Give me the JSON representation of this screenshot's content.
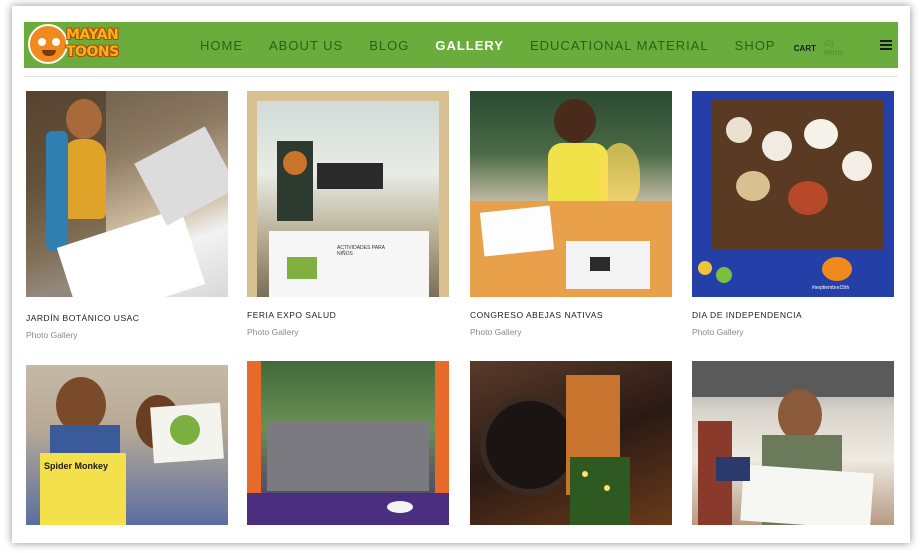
{
  "brand": {
    "logo_text": "MAYAN TOONS"
  },
  "nav": {
    "items": [
      {
        "label": "HOME"
      },
      {
        "label": "ABOUT US"
      },
      {
        "label": "BLOG"
      },
      {
        "label": "GALLERY"
      },
      {
        "label": "EDUCATIONAL MATERIAL"
      },
      {
        "label": "SHOP"
      }
    ],
    "active": "GALLERY",
    "cart_label": "CART",
    "cart_count": "(0) items",
    "menu_icon": "hamburger-icon"
  },
  "gallery": {
    "items": [
      {
        "title": "JARDÍN BOTÁNICO USAC",
        "subtitle": "Photo Gallery"
      },
      {
        "title": "FERIA EXPO SALUD",
        "subtitle": "Photo Gallery"
      },
      {
        "title": "CONGRESO ABEJAS NATIVAS",
        "subtitle": "Photo Gallery"
      },
      {
        "title": "DIA DE INDEPENDENCIA",
        "subtitle": "Photo Gallery"
      },
      {
        "title": "",
        "subtitle": ""
      },
      {
        "title": "",
        "subtitle": ""
      },
      {
        "title": "",
        "subtitle": ""
      },
      {
        "title": "",
        "subtitle": ""
      }
    ],
    "photo_labels": {
      "stand_banner": "ACTIVIDADES PARA NIÑOS",
      "book_cover": "Spider Monkey",
      "hashtag": "#septiembre15th"
    }
  },
  "colors": {
    "nav_bg": "#6aad3d",
    "nav_active": "#ffffff",
    "nav_text": "#2f5e16",
    "logo": "#f7b21e"
  }
}
